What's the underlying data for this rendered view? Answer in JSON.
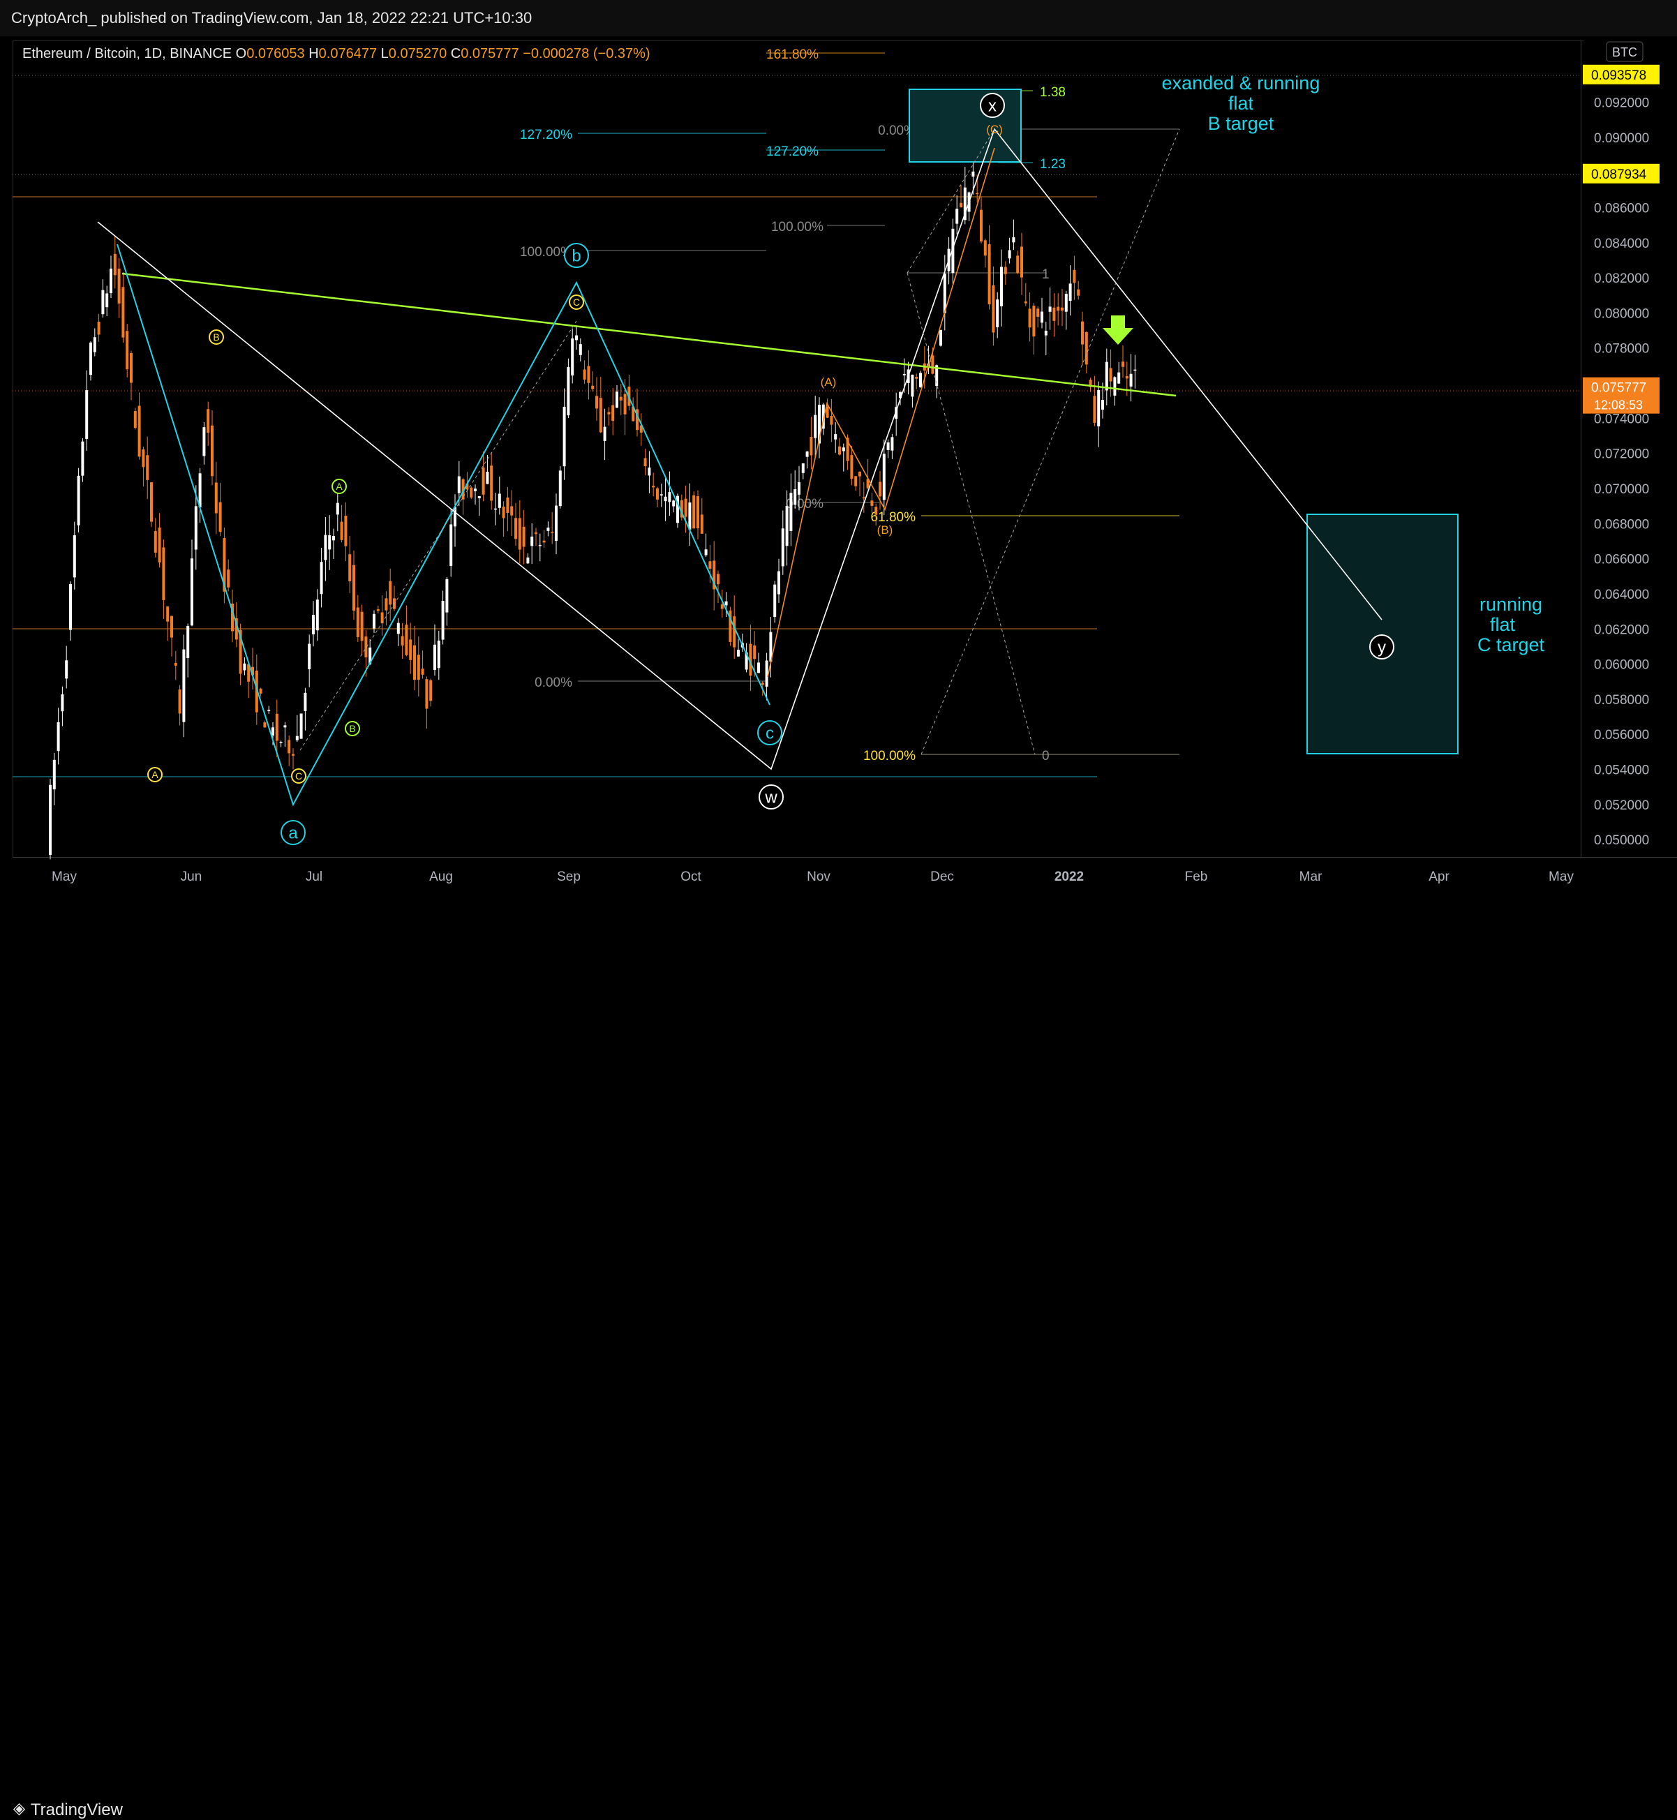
{
  "header": {
    "publisher": "CryptoArch_ published on TradingView.com, Jan 18, 2022 22:21 UTC+10:30"
  },
  "footer": {
    "brand": "TradingView"
  },
  "colors": {
    "bull": "#ffffff",
    "bear": "#f57c1f",
    "cyan": "#22d3e6",
    "green": "#a6ff2e",
    "yellow": "#ffe23a",
    "orange": "#f59a23",
    "price_tag": "#f4801e",
    "level_tag": "#fff200"
  },
  "chart_data": {
    "type": "candlestick",
    "symbol": "Ethereum / Bitcoin, 1D, BINANCE",
    "ohlc_bar": {
      "O": "0.076053",
      "H": "0.076477",
      "L": "0.075270",
      "C": "0.075777",
      "chg": "−0.000278 (−0.37%)"
    },
    "price_scale_currency": "BTC",
    "ylim": [
      0.0493,
      0.0952
    ],
    "y_ticks": [
      "0.092000",
      "0.090000",
      "0.086000",
      "0.084000",
      "0.082000",
      "0.080000",
      "0.078000",
      "0.074000",
      "0.072000",
      "0.070000",
      "0.068000",
      "0.066000",
      "0.064000",
      "0.062000",
      "0.060000",
      "0.058000",
      "0.056000",
      "0.054000",
      "0.052000",
      "0.050000"
    ],
    "x_ticks": [
      "May",
      "Jun",
      "Jul",
      "Aug",
      "Sep",
      "Oct",
      "Nov",
      "Dec",
      "2022",
      "Feb",
      "Mar",
      "Apr",
      "May"
    ],
    "price_tags": [
      {
        "label": "0.093578",
        "value": 0.093578,
        "kind": "level"
      },
      {
        "label": "0.087934",
        "value": 0.087934,
        "kind": "level"
      },
      {
        "label": "0.075777",
        "value": 0.075777,
        "kind": "last",
        "countdown": "12:08:53"
      }
    ],
    "fib_labels": [
      {
        "text": "161.80%",
        "color": "orange"
      },
      {
        "text": "127.20%",
        "color": "cyan"
      },
      {
        "text": "127.20%",
        "color": "cyan"
      },
      {
        "text": "100.00%",
        "color": "gray"
      },
      {
        "text": "100.00%",
        "color": "gray"
      },
      {
        "text": "0.00%",
        "color": "gray"
      },
      {
        "text": "0.00%",
        "color": "gray"
      },
      {
        "text": "0.00%",
        "color": "gray"
      },
      {
        "text": "61.80%",
        "color": "yellow"
      },
      {
        "text": "100.00%",
        "color": "yellow"
      },
      {
        "text": "1.38",
        "color": "green"
      },
      {
        "text": "1.23",
        "color": "cyan"
      },
      {
        "text": "1",
        "color": "gray"
      },
      {
        "text": "0",
        "color": "gray"
      }
    ],
    "wave_labels": [
      "a",
      "b",
      "c",
      "w",
      "x",
      "y",
      "A",
      "B",
      "C",
      "A",
      "B",
      "C",
      "(A)",
      "(B)",
      "(C)"
    ],
    "annotations": [
      {
        "lines": [
          "exanded & running",
          "flat",
          "B target"
        ],
        "color": "cyan"
      },
      {
        "lines": [
          "running",
          "flat",
          "C target"
        ],
        "color": "cyan"
      }
    ]
  }
}
